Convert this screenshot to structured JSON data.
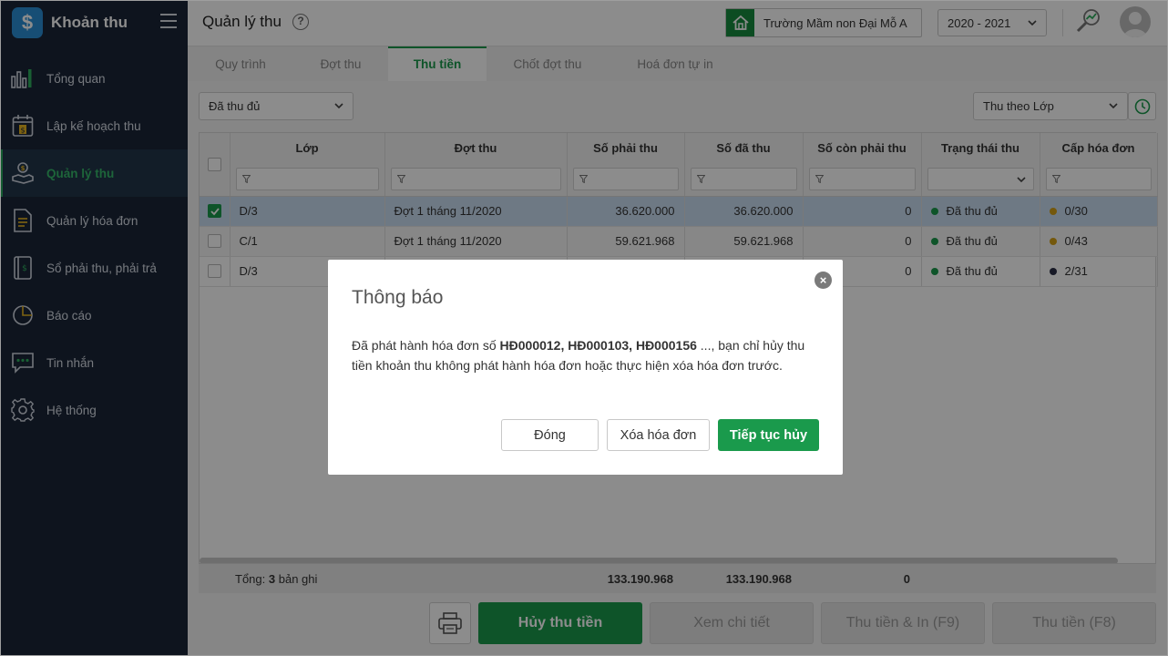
{
  "app": {
    "name": "Khoản thu"
  },
  "sidebar": {
    "items": [
      {
        "label": "Tổng quan",
        "icon": "bar-chart-icon"
      },
      {
        "label": "Lập kế hoạch thu",
        "icon": "calendar-money-icon"
      },
      {
        "label": "Quản lý thu",
        "icon": "hand-coin-icon",
        "active": true
      },
      {
        "label": "Quản lý hóa đơn",
        "icon": "document-icon"
      },
      {
        "label": "Sổ phải thu, phải trả",
        "icon": "ledger-icon"
      },
      {
        "label": "Báo cáo",
        "icon": "pie-chart-icon"
      },
      {
        "label": "Tin nhắn",
        "icon": "chat-icon"
      },
      {
        "label": "Hệ thống",
        "icon": "gear-icon"
      }
    ]
  },
  "header": {
    "title": "Quản lý thu",
    "help": "?",
    "school": "Trường Mầm non Đại Mỗ A",
    "year": "2020 - 2021"
  },
  "tabs": [
    "Quy trình",
    "Đợt thu",
    "Thu tiền",
    "Chốt đợt thu",
    "Hoá đơn tự in"
  ],
  "filters": {
    "status": "Đã thu đủ",
    "group_by": "Thu theo Lớp"
  },
  "table": {
    "columns": [
      "Lớp",
      "Đợt thu",
      "Số phải thu",
      "Số đã thu",
      "Số còn phải thu",
      "Trạng thái thu",
      "Cấp hóa đơn"
    ],
    "rows": [
      {
        "checked": true,
        "class": "D/3",
        "period": "Đợt 1 tháng 11/2020",
        "due": "36.620.000",
        "paid": "36.620.000",
        "remaining": "0",
        "status": "Đã thu đủ",
        "invoice": "0/30"
      },
      {
        "checked": false,
        "class": "C/1",
        "period": "Đợt 1 tháng 11/2020",
        "due": "59.621.968",
        "paid": "59.621.968",
        "remaining": "0",
        "status": "Đã thu đủ",
        "invoice": "0/43"
      },
      {
        "checked": false,
        "class": "D/3",
        "period": "",
        "due": "",
        "paid": "",
        "remaining": "0",
        "status": "Đã thu đủ",
        "invoice": "2/31"
      }
    ],
    "footer": {
      "total_label": "Tổng:",
      "total_count": "3",
      "total_suffix": "bản ghi",
      "due": "133.190.968",
      "paid": "133.190.968",
      "remaining": "0"
    }
  },
  "actions": {
    "cancel_payment": "Hủy thu tiền",
    "view_detail": "Xem chi tiết",
    "collect_print": "Thu tiền & In (F9)",
    "collect": "Thu tiền (F8)"
  },
  "colors": {
    "accent": "#1a9a4c",
    "sidebar_bg": "#1a2638",
    "status_green": "#1a9a4c",
    "invoice_partial": "#d4a017",
    "invoice_dark": "#2b2f45"
  },
  "dialog": {
    "title": "Thông báo",
    "msg_prefix": "Đã phát hành hóa đơn số ",
    "msg_invoices": "HĐ000012, HĐ000103, HĐ000156",
    "msg_suffix": " ..., bạn chỉ hủy thu tiền khoản thu không phát hành hóa đơn hoặc thực hiện xóa hóa đơn trước.",
    "btn_close": "Đóng",
    "btn_delete_invoice": "Xóa hóa đơn",
    "btn_continue": "Tiếp tục hủy"
  }
}
